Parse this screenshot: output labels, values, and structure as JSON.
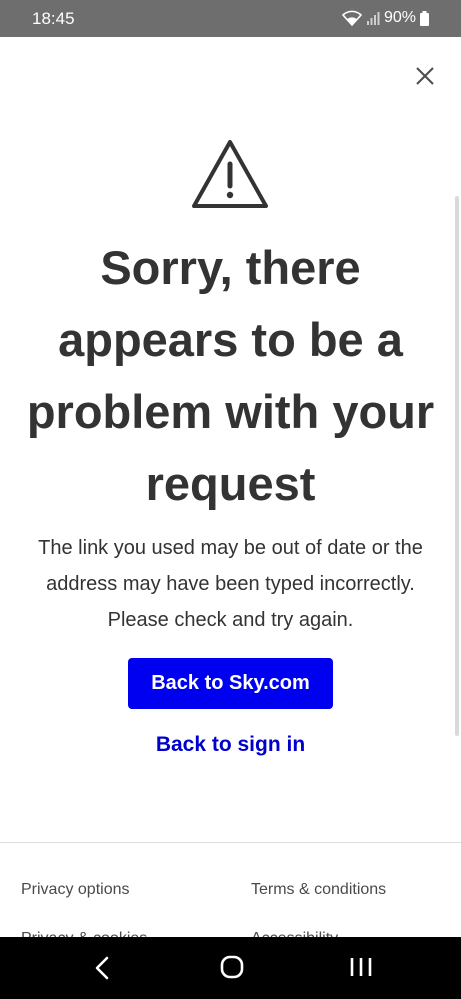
{
  "status_bar": {
    "time": "18:45",
    "battery": "90%"
  },
  "error": {
    "headline": "Sorry, there appears to be a problem with your request",
    "message": "The link you used may be out of date or the address may have been typed incorrectly. Please check and try again."
  },
  "actions": {
    "primary_label": "Back to Sky.com",
    "secondary_label": "Back to sign in"
  },
  "footer": {
    "links": [
      "Privacy options",
      "Terms & conditions",
      "Privacy & cookies",
      "Accessibility"
    ]
  },
  "colors": {
    "primary": "#0000f0",
    "link": "#0000cc",
    "text": "#333333"
  },
  "icons": [
    "wifi-icon",
    "signal-icon",
    "battery-icon",
    "close-icon",
    "warning-icon",
    "back-nav-icon",
    "home-nav-icon",
    "recents-nav-icon"
  ]
}
